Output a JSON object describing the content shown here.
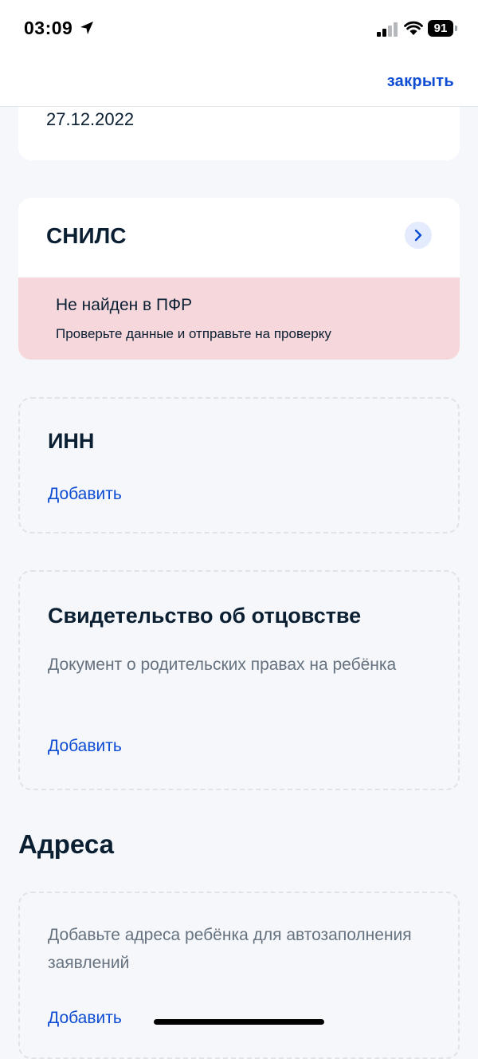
{
  "status_bar": {
    "time": "03:09",
    "battery": "91"
  },
  "header": {
    "close_label": "закрыть"
  },
  "birth_card": {
    "date": "27.12.2022"
  },
  "snils": {
    "title": "СНИЛС",
    "alert_title": "Не найден в ПФР",
    "alert_text": "Проверьте данные и отправьте на проверку"
  },
  "inn": {
    "title": "ИНН",
    "add_label": "Добавить"
  },
  "paternity": {
    "title": "Свидетельство об отцовстве",
    "description": "Документ о родительских правах на ребёнка",
    "add_label": "Добавить"
  },
  "addresses": {
    "section_title": "Адреса",
    "description": "Добавьте адреса ребёнка для автозаполнения заявлений",
    "add_label": "Добавить"
  },
  "colors": {
    "accent": "#0d4cd3",
    "error_bg": "#f6d8dc",
    "page_bg": "#f5f7fa"
  },
  "icons": [
    "location-arrow-icon",
    "cellular-signal-icon",
    "wifi-icon",
    "battery-icon",
    "chevron-right-icon"
  ]
}
